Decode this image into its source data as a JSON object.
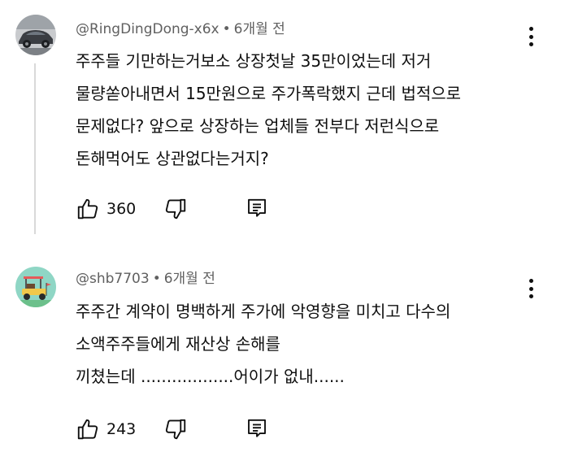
{
  "comments": [
    {
      "author": "@RingDingDong-x6x",
      "separator": "•",
      "time": "6개월 전",
      "lines": [
        "주주들 기만하는거보소 상장첫날 35만이었는데 저거",
        "물량쏟아내면서 15만원으로 주가폭락했지 근데 법적으로",
        "문제없다? 앞으로 상장하는 업체들 전부다 저런식으로",
        "돈해먹어도 상관없다는거지?"
      ],
      "likes": "360"
    },
    {
      "author": "@shb7703",
      "separator": "•",
      "time": "6개월 전",
      "lines": [
        "주주간 계약이 명백하게 주가에 악영향을 미치고 다수의",
        "소액주주들에게 재산상 손해를",
        "끼쳤는데 ..................어이가 없내......"
      ],
      "likes": "243"
    }
  ],
  "icons": {
    "like": "thumbs-up-icon",
    "dislike": "thumbs-down-icon",
    "reply": "reply-icon",
    "menu": "more-vert-icon"
  },
  "colors": {
    "text": "#0f0f0f",
    "meta": "#606060",
    "avatar2_bg": "#8fd6c5"
  }
}
